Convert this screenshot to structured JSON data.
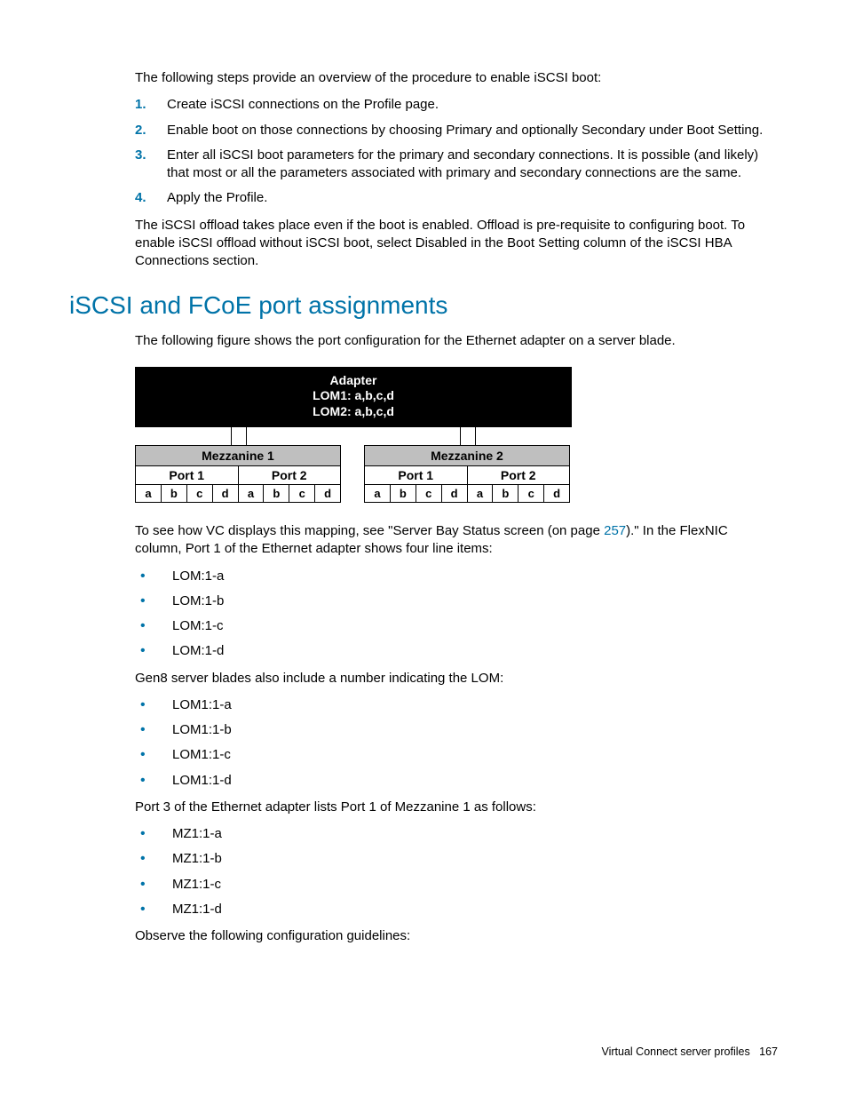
{
  "intro1": "The following steps provide an overview of the procedure to enable iSCSI boot:",
  "steps": [
    "Create iSCSI connections on the Profile page.",
    "Enable boot on those connections by choosing Primary and optionally Secondary under Boot Setting.",
    "Enter all iSCSI boot parameters for the primary and secondary connections. It is possible (and likely) that most or all the parameters associated with primary and secondary connections are the same.",
    "Apply the Profile."
  ],
  "intro2": "The iSCSI offload takes place even if the boot is enabled. Offload is pre-requisite to configuring boot. To enable iSCSI offload without iSCSI boot, select Disabled in the Boot Setting column of the iSCSI HBA Connections section.",
  "section_title": "iSCSI and FCoE port assignments",
  "fig_intro": "The following figure shows the port configuration for the Ethernet adapter on a server blade.",
  "adapter": {
    "title": "Adapter",
    "lom1": "LOM1: a,b,c,d",
    "lom2": "LOM2: a,b,c,d"
  },
  "mezz": [
    {
      "name": "Mezzanine 1",
      "ports": [
        "Port 1",
        "Port 2"
      ],
      "sub": [
        "a",
        "b",
        "c",
        "d"
      ]
    },
    {
      "name": "Mezzanine 2",
      "ports": [
        "Port 1",
        "Port 2"
      ],
      "sub": [
        "a",
        "b",
        "c",
        "d"
      ]
    }
  ],
  "para_after_fig_a": "To see how VC displays this mapping, see \"Server Bay Status screen (on page ",
  "link_page": "257",
  "para_after_fig_b": ").\" In the FlexNIC column, Port 1 of the Ethernet adapter shows four line items:",
  "list_lom": [
    "LOM:1-a",
    "LOM:1-b",
    "LOM:1-c",
    "LOM:1-d"
  ],
  "gen8": "Gen8 server blades also include a number indicating the LOM:",
  "list_lom1": [
    "LOM1:1-a",
    "LOM1:1-b",
    "LOM1:1-c",
    "LOM1:1-d"
  ],
  "port3": "Port 3 of the Ethernet adapter lists Port 1 of Mezzanine 1 as follows:",
  "list_mz": [
    "MZ1:1-a",
    "MZ1:1-b",
    "MZ1:1-c",
    "MZ1:1-d"
  ],
  "observe": "Observe the following configuration guidelines:",
  "footer_label": "Virtual Connect server profiles",
  "footer_page": "167"
}
